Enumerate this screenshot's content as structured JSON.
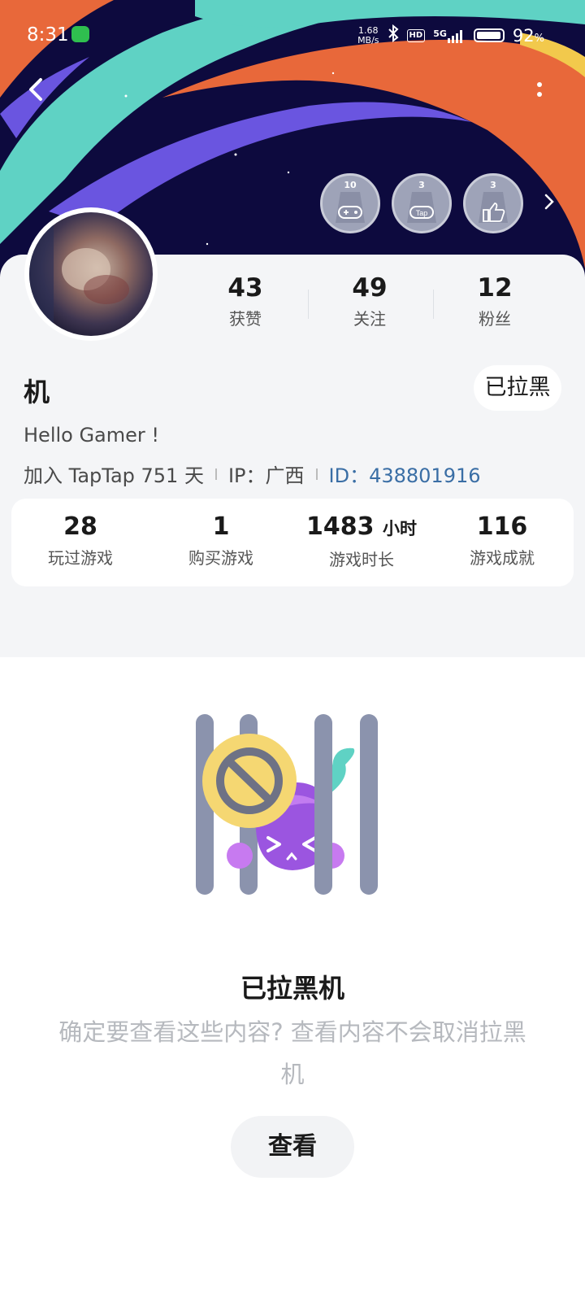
{
  "status_bar": {
    "time": "8:31",
    "net_speed_value": "1.68",
    "net_speed_unit": "MB/s",
    "hd": "HD",
    "network": "5G",
    "battery_pct": "92",
    "battery_unit": "%"
  },
  "badges": [
    {
      "icon": "gamepad-badge-icon",
      "count": "10"
    },
    {
      "icon": "tap-badge-icon",
      "count": "3"
    },
    {
      "icon": "thumbs-up-badge-icon",
      "count": "3"
    }
  ],
  "profile": {
    "likes": {
      "value": "43",
      "label": "获赞"
    },
    "following": {
      "value": "49",
      "label": "关注"
    },
    "fans": {
      "value": "12",
      "label": "粉丝"
    },
    "username": "机",
    "blocked_button": "已拉黑",
    "bio": "Hello Gamer !",
    "join": "加入 TapTap 751 天",
    "ip": "IP：广西",
    "id": "ID：438801916"
  },
  "game_stats": [
    {
      "value": "28",
      "unit": "",
      "label": "玩过游戏"
    },
    {
      "value": "1",
      "unit": "",
      "label": "购买游戏"
    },
    {
      "value": "1483",
      "unit": "小时",
      "label": "游戏时长"
    },
    {
      "value": "116",
      "unit": "",
      "label": "游戏成就"
    }
  ],
  "blocked_notice": {
    "title": "已拉黑机",
    "description": "确定要查看这些内容? 查看内容不会取消拉黑机",
    "view_button": "查看"
  },
  "colors": {
    "banner_bg": "#0d0a3e",
    "accent_teal": "#5fd2c4",
    "accent_orange": "#e8683a",
    "accent_purple": "#6a55e0",
    "id_link": "#3a6ea5"
  }
}
